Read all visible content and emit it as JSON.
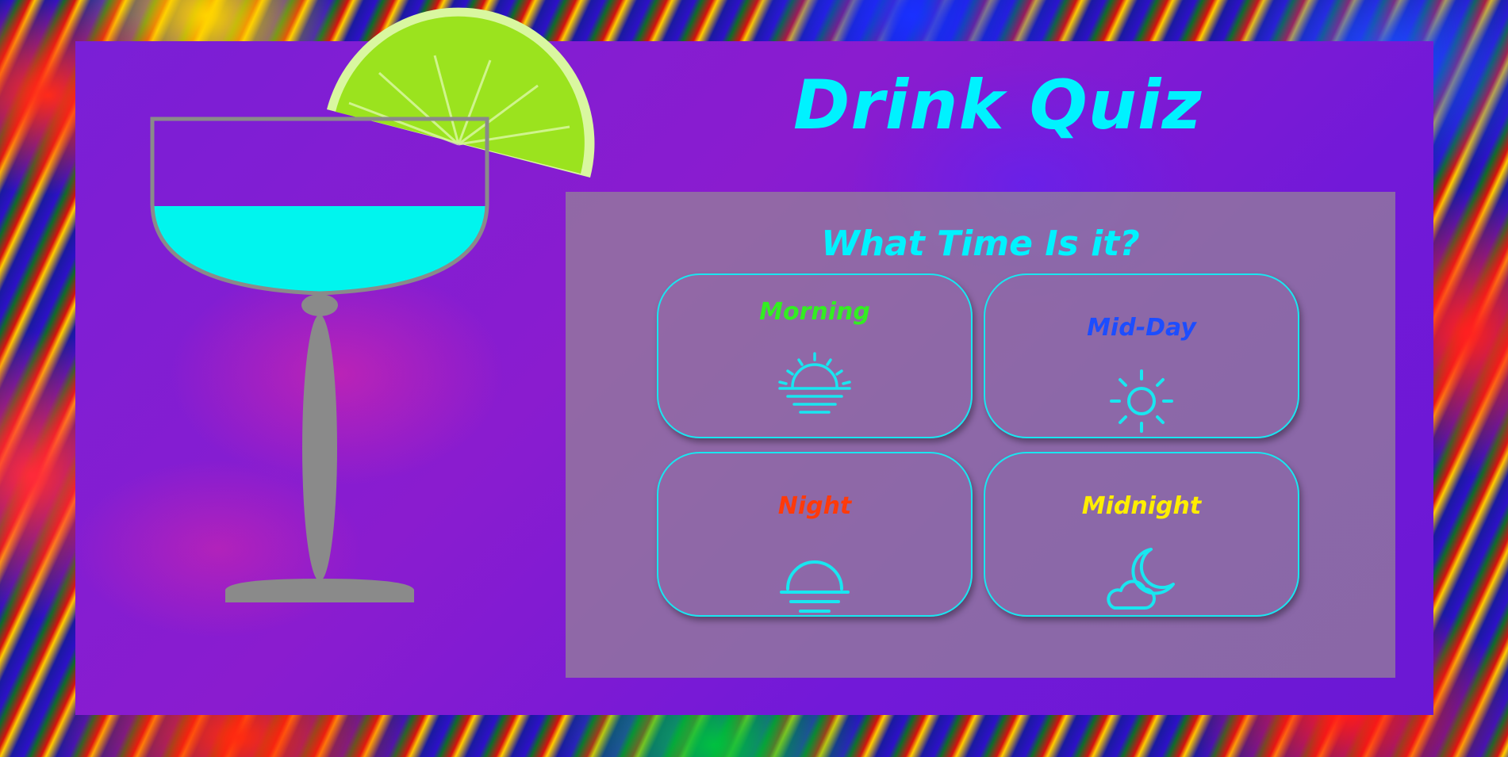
{
  "header": {
    "title": "Drink Quiz"
  },
  "quiz": {
    "question": "What Time Is it?",
    "options": [
      {
        "label": "Morning",
        "icon": "sunrise-icon",
        "color": "#33ee22"
      },
      {
        "label": "Mid-Day",
        "icon": "sun-icon",
        "color": "#1d4dff"
      },
      {
        "label": "Night",
        "icon": "sunset-icon",
        "color": "#ff3a0a"
      },
      {
        "label": "Midnight",
        "icon": "moon-cloud-icon",
        "color": "#ffee00"
      }
    ]
  },
  "colors": {
    "accent": "#00f2ff",
    "panel": "#7a1fd6",
    "drink": "#00f5ee",
    "lime": "#9be31e",
    "glass": "#8a8a8a"
  }
}
